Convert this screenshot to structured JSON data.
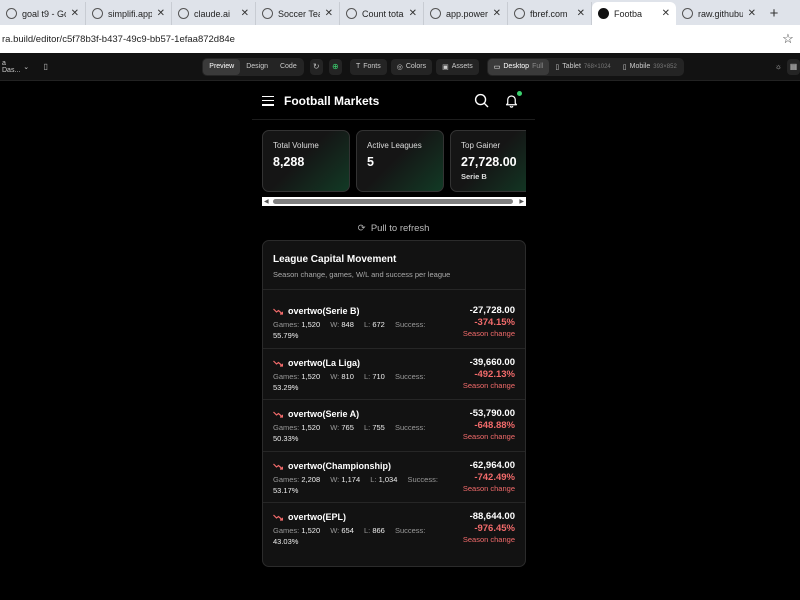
{
  "browser": {
    "tabs": [
      {
        "title": "goal t9 - Go",
        "active": false
      },
      {
        "title": "simplifi.app",
        "active": false
      },
      {
        "title": "claude.ai",
        "active": false
      },
      {
        "title": "Soccer Team",
        "active": false
      },
      {
        "title": "Count total",
        "active": false
      },
      {
        "title": "app.powerb",
        "active": false
      },
      {
        "title": "fbref.com",
        "active": false
      },
      {
        "title": "Footba",
        "active": true
      },
      {
        "title": "raw.githubu",
        "active": false
      }
    ],
    "new_tab_label": "+",
    "url": "ra.build/editor/c5f78b3f-b437-49c9-bb57-1efaa872d84e"
  },
  "editor": {
    "workspace": "a Das...",
    "modes": [
      "Preview",
      "Design",
      "Code"
    ],
    "active_mode": "Preview",
    "fonts_label": "Fonts",
    "colors_label": "Colors",
    "assets_label": "Assets",
    "devices": [
      {
        "label": "Desktop",
        "meta": "Full"
      },
      {
        "label": "Tablet",
        "meta": "768×1024"
      },
      {
        "label": "Mobile",
        "meta": "393×852"
      }
    ]
  },
  "app": {
    "title": "Football Markets",
    "cards": [
      {
        "label": "Total Volume",
        "value": "8,288",
        "sub": ""
      },
      {
        "label": "Active Leagues",
        "value": "5",
        "sub": ""
      },
      {
        "label": "Top Gainer",
        "value": "27,728.00",
        "sub": "Serie B"
      }
    ],
    "refresh_text": "Pull to refresh",
    "panel": {
      "title": "League Capital Movement",
      "subtitle": "Season change, games, W/L and success per league",
      "games_label": "Games:",
      "wins_label": "W:",
      "losses_label": "L:",
      "success_label": "Success:",
      "change_label": "Season change",
      "rows": [
        {
          "name": "overtwo(Serie B)",
          "games": "1,520",
          "wins": "848",
          "losses": "672",
          "success": "55.79%",
          "amount": "-27,728.00",
          "pct": "-374.15%"
        },
        {
          "name": "overtwo(La Liga)",
          "games": "1,520",
          "wins": "810",
          "losses": "710",
          "success": "53.29%",
          "amount": "-39,660.00",
          "pct": "-492.13%"
        },
        {
          "name": "overtwo(Serie A)",
          "games": "1,520",
          "wins": "765",
          "losses": "755",
          "success": "50.33%",
          "amount": "-53,790.00",
          "pct": "-648.88%"
        },
        {
          "name": "overtwo(Championship)",
          "games": "2,208",
          "wins": "1,174",
          "losses": "1,034",
          "success": "53.17%",
          "amount": "-62,964.00",
          "pct": "-742.49%"
        },
        {
          "name": "overtwo(EPL)",
          "games": "1,520",
          "wins": "654",
          "losses": "866",
          "success": "43.03%",
          "amount": "-88,644.00",
          "pct": "-976.45%"
        }
      ]
    }
  },
  "colors": {
    "accent_green": "#3bd16f",
    "negative_red": "#f26b6b",
    "background": "#000000"
  }
}
